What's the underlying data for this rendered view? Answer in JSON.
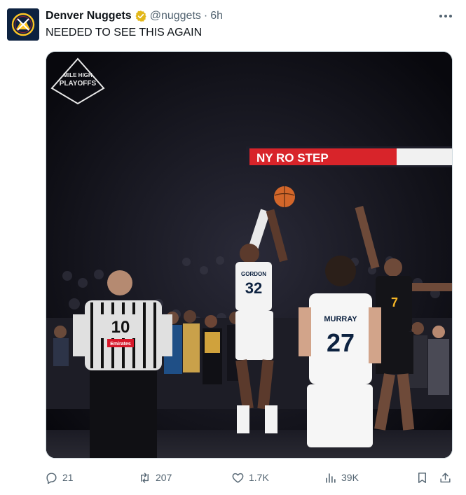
{
  "tweet": {
    "author_name": "Denver Nuggets",
    "handle": "@nuggets",
    "separator": "·",
    "time": "6h",
    "text": "NEEDED TO SEE THIS AGAIN",
    "verified_icon": "verified-badge-icon",
    "more_icon": "more-options-icon"
  },
  "media": {
    "watermark_line1": "MILE HIGH",
    "watermark_line2": "PLAYOFFS",
    "scoreboard_text": "NY RO STEP",
    "jersey_shooter": "32",
    "jersey_shooter_name": "GORDON",
    "jersey_murray": "27",
    "jersey_murray_name": "MURRAY",
    "jersey_defender": "7",
    "jersey_ref": "10",
    "ref_patch": "Emirates"
  },
  "actions": {
    "replies": "21",
    "reposts": "207",
    "likes": "1.7K",
    "views": "39K"
  },
  "colors": {
    "text": "#0f1419",
    "secondary": "#536471",
    "verified": "#e2b719",
    "border": "#cfd9de"
  }
}
